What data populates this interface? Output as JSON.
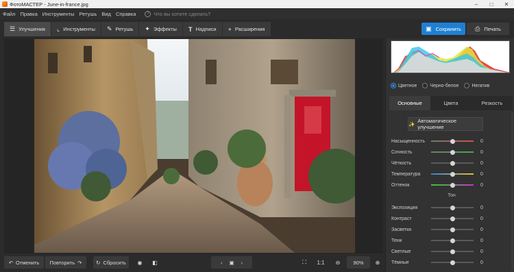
{
  "titlebar": {
    "title": "ФотоМАСТЕР - June-in-france.jpg"
  },
  "menu": {
    "items": [
      "Файл",
      "Правка",
      "Инструменты",
      "Ретушь",
      "Вид",
      "Справка"
    ],
    "search_placeholder": "Что вы хотите сделать?"
  },
  "tabs": [
    {
      "label": "Улучшения",
      "icon": "sliders-icon"
    },
    {
      "label": "Инструменты",
      "icon": "crop-icon"
    },
    {
      "label": "Ретушь",
      "icon": "brush-icon"
    },
    {
      "label": "Эффекты",
      "icon": "magic-wand-icon"
    },
    {
      "label": "Надписи",
      "icon": "text-icon"
    },
    {
      "label": "Расширения",
      "icon": "plus-icon"
    }
  ],
  "actions": {
    "save_label": "Сохранить",
    "print_label": "Печать"
  },
  "bottom": {
    "undo_label": "Отменить",
    "redo_label": "Повторить",
    "reset_label": "Сбросить",
    "actual_size_label": "1:1",
    "zoom_value": "90%"
  },
  "panel": {
    "modes": [
      {
        "label": "Цветное",
        "selected": true
      },
      {
        "label": "Черно-белое",
        "selected": false
      },
      {
        "label": "Негатив",
        "selected": false
      }
    ],
    "tabs": [
      "Основные",
      "Цвета",
      "Резкость"
    ],
    "auto_label": "Автоматическое улучшение",
    "tone_title": "Тон",
    "color_sliders": [
      {
        "label": "Насыщенность",
        "value": "0",
        "level": 0.5
      },
      {
        "label": "Сочность",
        "value": "0",
        "level": 0.5
      },
      {
        "label": "Чёткость",
        "value": "0",
        "level": 0.5
      },
      {
        "label": "Температура",
        "value": "0",
        "level": 0.5
      },
      {
        "label": "Оттенок",
        "value": "0",
        "level": 0.5
      }
    ],
    "tone_sliders": [
      {
        "label": "Экспозиция",
        "value": "0",
        "level": 0.5
      },
      {
        "label": "Контраст",
        "value": "0",
        "level": 0.5
      },
      {
        "label": "Засветки",
        "value": "0",
        "level": 0.5
      },
      {
        "label": "Тени",
        "value": "0",
        "level": 0.5
      },
      {
        "label": "Светлые",
        "value": "0",
        "level": 0.5
      },
      {
        "label": "Тёмные",
        "value": "0",
        "level": 0.5
      }
    ]
  },
  "colors": {
    "accent": "#1f80d3",
    "panel_bg": "#323232",
    "app_bg": "#2b2b2b"
  }
}
